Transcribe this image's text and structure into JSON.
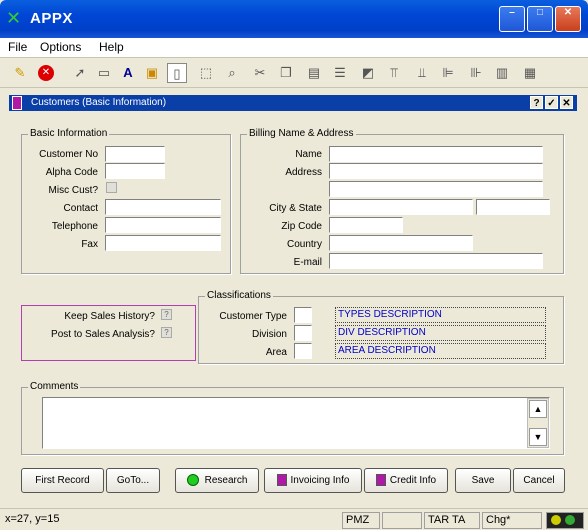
{
  "app": {
    "title": "APPX"
  },
  "menu": [
    "File",
    "Options",
    "Help"
  ],
  "toolbar": {
    "icons": [
      "edit-icon",
      "cancel-icon",
      "pointer-icon",
      "rectangle-icon",
      "text-icon",
      "image-icon",
      "page-icon",
      "select-box-icon",
      "zoom-icon",
      "cut-icon",
      "copy-icon",
      "paste-icon",
      "list-icon",
      "layer-icon",
      "align-top-icon",
      "align-bottom-icon",
      "align-left-icon",
      "align-right-icon",
      "distribute-h-icon",
      "distribute-v-icon"
    ]
  },
  "window": {
    "title": "Customers (Basic Information)"
  },
  "basic": {
    "legend": "Basic Information",
    "labels": [
      "Customer No",
      "Alpha Code",
      "Misc Cust?",
      "Contact",
      "Telephone",
      "Fax"
    ]
  },
  "billing": {
    "legend": "Billing Name & Address",
    "labels": [
      "Name",
      "Address",
      "City & State",
      "Zip Code",
      "Country",
      "E-mail"
    ]
  },
  "sales": {
    "keep_label": "Keep Sales History?",
    "post_label": "Post to Sales Analysis?",
    "keep_value": "?",
    "post_value": "?"
  },
  "classifications": {
    "legend": "Classifications",
    "labels": [
      "Customer Type",
      "Division",
      "Area"
    ],
    "descs": [
      "TYPES DESCRIPTION",
      "DIV DESCRIPTION",
      "AREA DESCRIPTION"
    ]
  },
  "comments": {
    "legend": "Comments"
  },
  "buttons": {
    "first": "First Record",
    "goto": "GoTo...",
    "research": "Research",
    "invoicing": "Invoicing Info",
    "credit": "Credit Info",
    "save": "Save",
    "cancel": "Cancel"
  },
  "status": {
    "coords": "x=27, y=15",
    "pmz": "PMZ",
    "tar": "TAR TA",
    "chg": "Chg*"
  }
}
